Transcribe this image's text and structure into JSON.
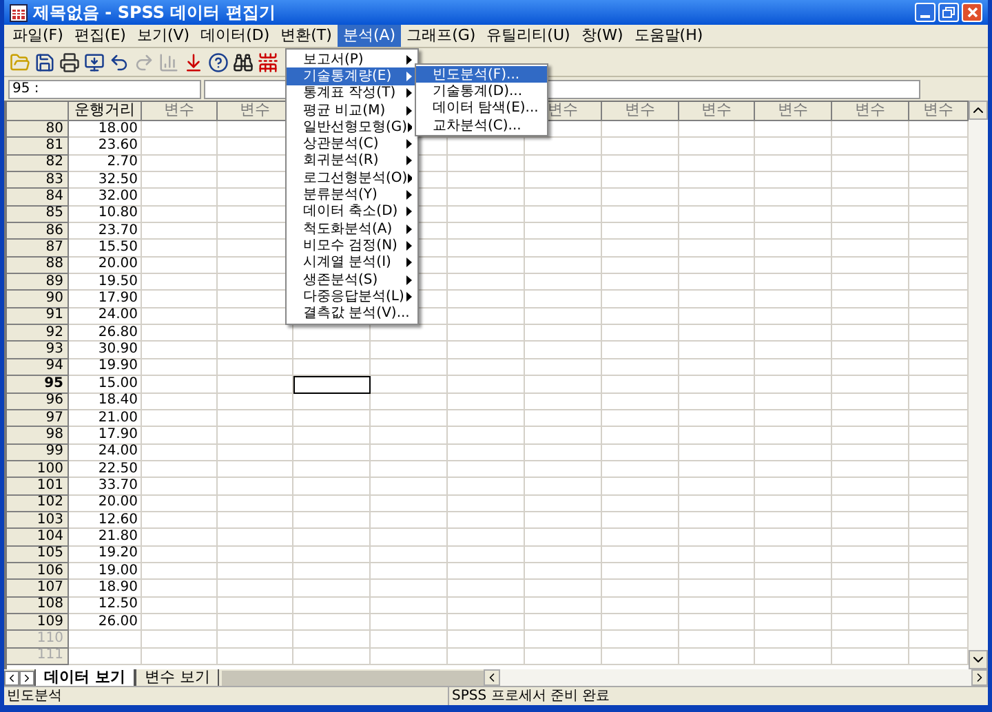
{
  "window": {
    "title": "제목없음 - SPSS 데이터 편집기"
  },
  "menu_bar": [
    {
      "label": "파일(F)",
      "selected": false
    },
    {
      "label": "편집(E)",
      "selected": false
    },
    {
      "label": "보기(V)",
      "selected": false
    },
    {
      "label": "데이터(D)",
      "selected": false
    },
    {
      "label": "변환(T)",
      "selected": false
    },
    {
      "label": "분석(A)",
      "selected": true
    },
    {
      "label": "그래프(G)",
      "selected": false
    },
    {
      "label": "유틸리티(U)",
      "selected": false
    },
    {
      "label": "창(W)",
      "selected": false
    },
    {
      "label": "도움말(H)",
      "selected": false
    }
  ],
  "toolbar": [
    {
      "kind": "open",
      "disabled": false
    },
    {
      "kind": "save",
      "disabled": false
    },
    {
      "kind": "print",
      "disabled": false
    },
    {
      "kind": "recall",
      "disabled": false
    },
    {
      "kind": "undo",
      "disabled": false
    },
    {
      "kind": "redo",
      "disabled": true
    },
    {
      "kind": "chart",
      "disabled": true
    },
    {
      "kind": "goto",
      "disabled": false
    },
    {
      "kind": "variables",
      "disabled": false
    },
    {
      "kind": "find",
      "disabled": false
    },
    {
      "kind": "insert",
      "disabled": false
    }
  ],
  "cell_editor": {
    "cell": "95 :"
  },
  "analyze_menu": {
    "items": [
      {
        "label": "보고서(P)",
        "submenu": true,
        "selected": false
      },
      {
        "label": "기술통계량(E)",
        "submenu": true,
        "selected": true
      },
      {
        "label": "통계표 작성(T)",
        "submenu": true,
        "selected": false
      },
      {
        "label": "평균 비교(M)",
        "submenu": true,
        "selected": false
      },
      {
        "label": "일반선형모형(G)",
        "submenu": true,
        "selected": false
      },
      {
        "label": "상관분석(C)",
        "submenu": true,
        "selected": false
      },
      {
        "label": "회귀분석(R)",
        "submenu": true,
        "selected": false
      },
      {
        "label": "로그선형분석(O)",
        "submenu": true,
        "selected": false
      },
      {
        "label": "분류분석(Y)",
        "submenu": true,
        "selected": false
      },
      {
        "label": "데이터 축소(D)",
        "submenu": true,
        "selected": false
      },
      {
        "label": "척도화분석(A)",
        "submenu": true,
        "selected": false
      },
      {
        "label": "비모수 검정(N)",
        "submenu": true,
        "selected": false
      },
      {
        "label": "시계열 분석(I)",
        "submenu": true,
        "selected": false
      },
      {
        "label": "생존분석(S)",
        "submenu": true,
        "selected": false
      },
      {
        "label": "다중응답분석(L)",
        "submenu": true,
        "selected": false
      },
      {
        "label": "결측값 분석(V)...",
        "submenu": false,
        "selected": false
      }
    ]
  },
  "descriptive_submenu": {
    "items": [
      {
        "label": "빈도분석(F)...",
        "selected": true
      },
      {
        "label": "기술통계(D)...",
        "selected": false
      },
      {
        "label": "데이터 탐색(E)...",
        "selected": false
      },
      {
        "label": "교차분석(C)...",
        "selected": false
      }
    ]
  },
  "table": {
    "columns": [
      {
        "label": "운행거리",
        "active": false
      },
      {
        "label": "변수",
        "active": false
      },
      {
        "label": "변수",
        "active": false
      },
      {
        "active": true
      },
      {
        "active": false
      },
      {
        "active": false
      },
      {
        "label": "변수",
        "active": false
      },
      {
        "label": "변수",
        "active": false
      },
      {
        "label": "변수",
        "active": false
      },
      {
        "label": "변수",
        "active": false
      },
      {
        "label": "변수",
        "active": false
      },
      {
        "label": "변수",
        "active": false
      }
    ],
    "rows": [
      {
        "number": "80",
        "value": "18.00",
        "active": false,
        "disabled": false
      },
      {
        "number": "81",
        "value": "23.60",
        "active": false,
        "disabled": false
      },
      {
        "number": "82",
        "value": "2.70",
        "active": false,
        "disabled": false
      },
      {
        "number": "83",
        "value": "32.50",
        "active": false,
        "disabled": false
      },
      {
        "number": "84",
        "value": "32.00",
        "active": false,
        "disabled": false
      },
      {
        "number": "85",
        "value": "10.80",
        "active": false,
        "disabled": false
      },
      {
        "number": "86",
        "value": "23.70",
        "active": false,
        "disabled": false
      },
      {
        "number": "87",
        "value": "15.50",
        "active": false,
        "disabled": false
      },
      {
        "number": "88",
        "value": "20.00",
        "active": false,
        "disabled": false
      },
      {
        "number": "89",
        "value": "19.50",
        "active": false,
        "disabled": false
      },
      {
        "number": "90",
        "value": "17.90",
        "active": false,
        "disabled": false
      },
      {
        "number": "91",
        "value": "24.00",
        "active": false,
        "disabled": false
      },
      {
        "number": "92",
        "value": "26.80",
        "active": false,
        "disabled": false
      },
      {
        "number": "93",
        "value": "30.90",
        "active": false,
        "disabled": false
      },
      {
        "number": "94",
        "value": "19.90",
        "active": false,
        "disabled": false
      },
      {
        "number": "95",
        "value": "15.00",
        "active": true,
        "disabled": false
      },
      {
        "number": "96",
        "value": "18.40",
        "active": false,
        "disabled": false
      },
      {
        "number": "97",
        "value": "21.00",
        "active": false,
        "disabled": false
      },
      {
        "number": "98",
        "value": "17.90",
        "active": false,
        "disabled": false
      },
      {
        "number": "99",
        "value": "24.00",
        "active": false,
        "disabled": false
      },
      {
        "number": "100",
        "value": "22.50",
        "active": false,
        "disabled": false
      },
      {
        "number": "101",
        "value": "33.70",
        "active": false,
        "disabled": false
      },
      {
        "number": "102",
        "value": "20.00",
        "active": false,
        "disabled": false
      },
      {
        "number": "103",
        "value": "12.60",
        "active": false,
        "disabled": false
      },
      {
        "number": "104",
        "value": "21.80",
        "active": false,
        "disabled": false
      },
      {
        "number": "105",
        "value": "19.20",
        "active": false,
        "disabled": false
      },
      {
        "number": "106",
        "value": "19.00",
        "active": false,
        "disabled": false
      },
      {
        "number": "107",
        "value": "18.90",
        "active": false,
        "disabled": false
      },
      {
        "number": "108",
        "value": "12.50",
        "active": false,
        "disabled": false
      },
      {
        "number": "109",
        "value": "26.00",
        "active": false,
        "disabled": false
      },
      {
        "number": "110",
        "active": false,
        "disabled": true
      },
      {
        "number": "111",
        "active": false,
        "disabled": true
      }
    ]
  },
  "sheet_tabs": [
    {
      "label": "데이터 보기",
      "selected": true
    },
    {
      "label": "변수 보기",
      "selected": false
    }
  ],
  "status_bar": {
    "message": "빈도분석",
    "processor": "SPSS 프로세서 준비 완료"
  }
}
